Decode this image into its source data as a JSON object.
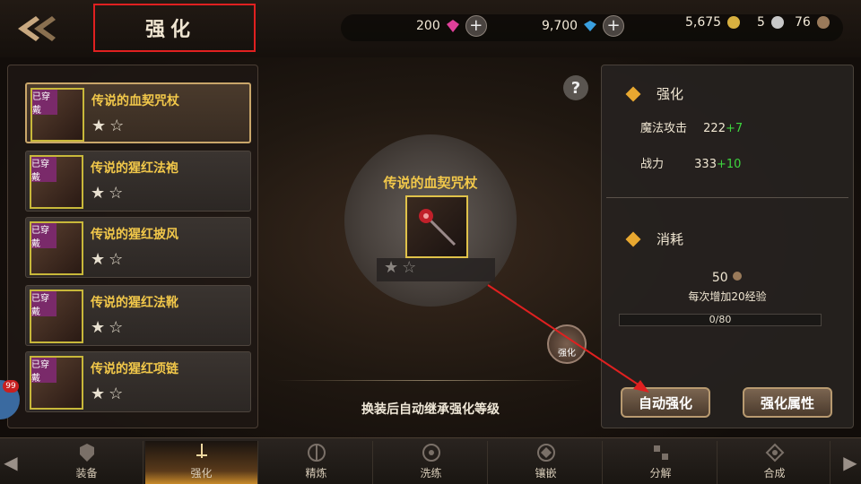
{
  "header": {
    "title": "强化",
    "currencies": [
      {
        "value": "200",
        "icon": "pink-gem-icon"
      },
      {
        "value": "9,700",
        "icon": "blue-diamond-icon"
      },
      {
        "value": "5,675",
        "icon": "gold-coin-icon"
      },
      {
        "value": "5",
        "icon": "silver-coin-icon"
      },
      {
        "value": "76",
        "icon": "bronze-coin-icon"
      }
    ]
  },
  "equipment": {
    "worn_tag": "已穿戴",
    "items": [
      {
        "name": "传说的血契咒杖",
        "stars": "★☆"
      },
      {
        "name": "传说的猩红法袍",
        "stars": "★☆"
      },
      {
        "name": "传说的猩红披风",
        "stars": "★☆"
      },
      {
        "name": "传说的猩红法靴",
        "stars": "★☆"
      },
      {
        "name": "传说的猩红项链",
        "stars": "★☆"
      }
    ]
  },
  "center": {
    "item_name": "传说的血契咒杖",
    "stars": "★☆",
    "hint": "换装后自动继承强化等级",
    "strengthen_label": "强化",
    "help": "?"
  },
  "panel": {
    "enhance_title": "强化",
    "stats": [
      {
        "label": "魔法攻击",
        "value": "222",
        "bonus": "+7"
      },
      {
        "label": "战力",
        "value": "333",
        "bonus": "+10"
      }
    ],
    "cost_title": "消耗",
    "cost_value": "50",
    "cost_note": "每次增加20经验",
    "xp_text": "0/80",
    "xp_progress": 0,
    "auto_button": "自动强化",
    "attr_button": "强化属性"
  },
  "nav": {
    "tabs": [
      "装备",
      "强化",
      "精炼",
      "洗练",
      "镶嵌",
      "分解",
      "合成"
    ],
    "active_index": 1
  },
  "notification_badge": "99"
}
